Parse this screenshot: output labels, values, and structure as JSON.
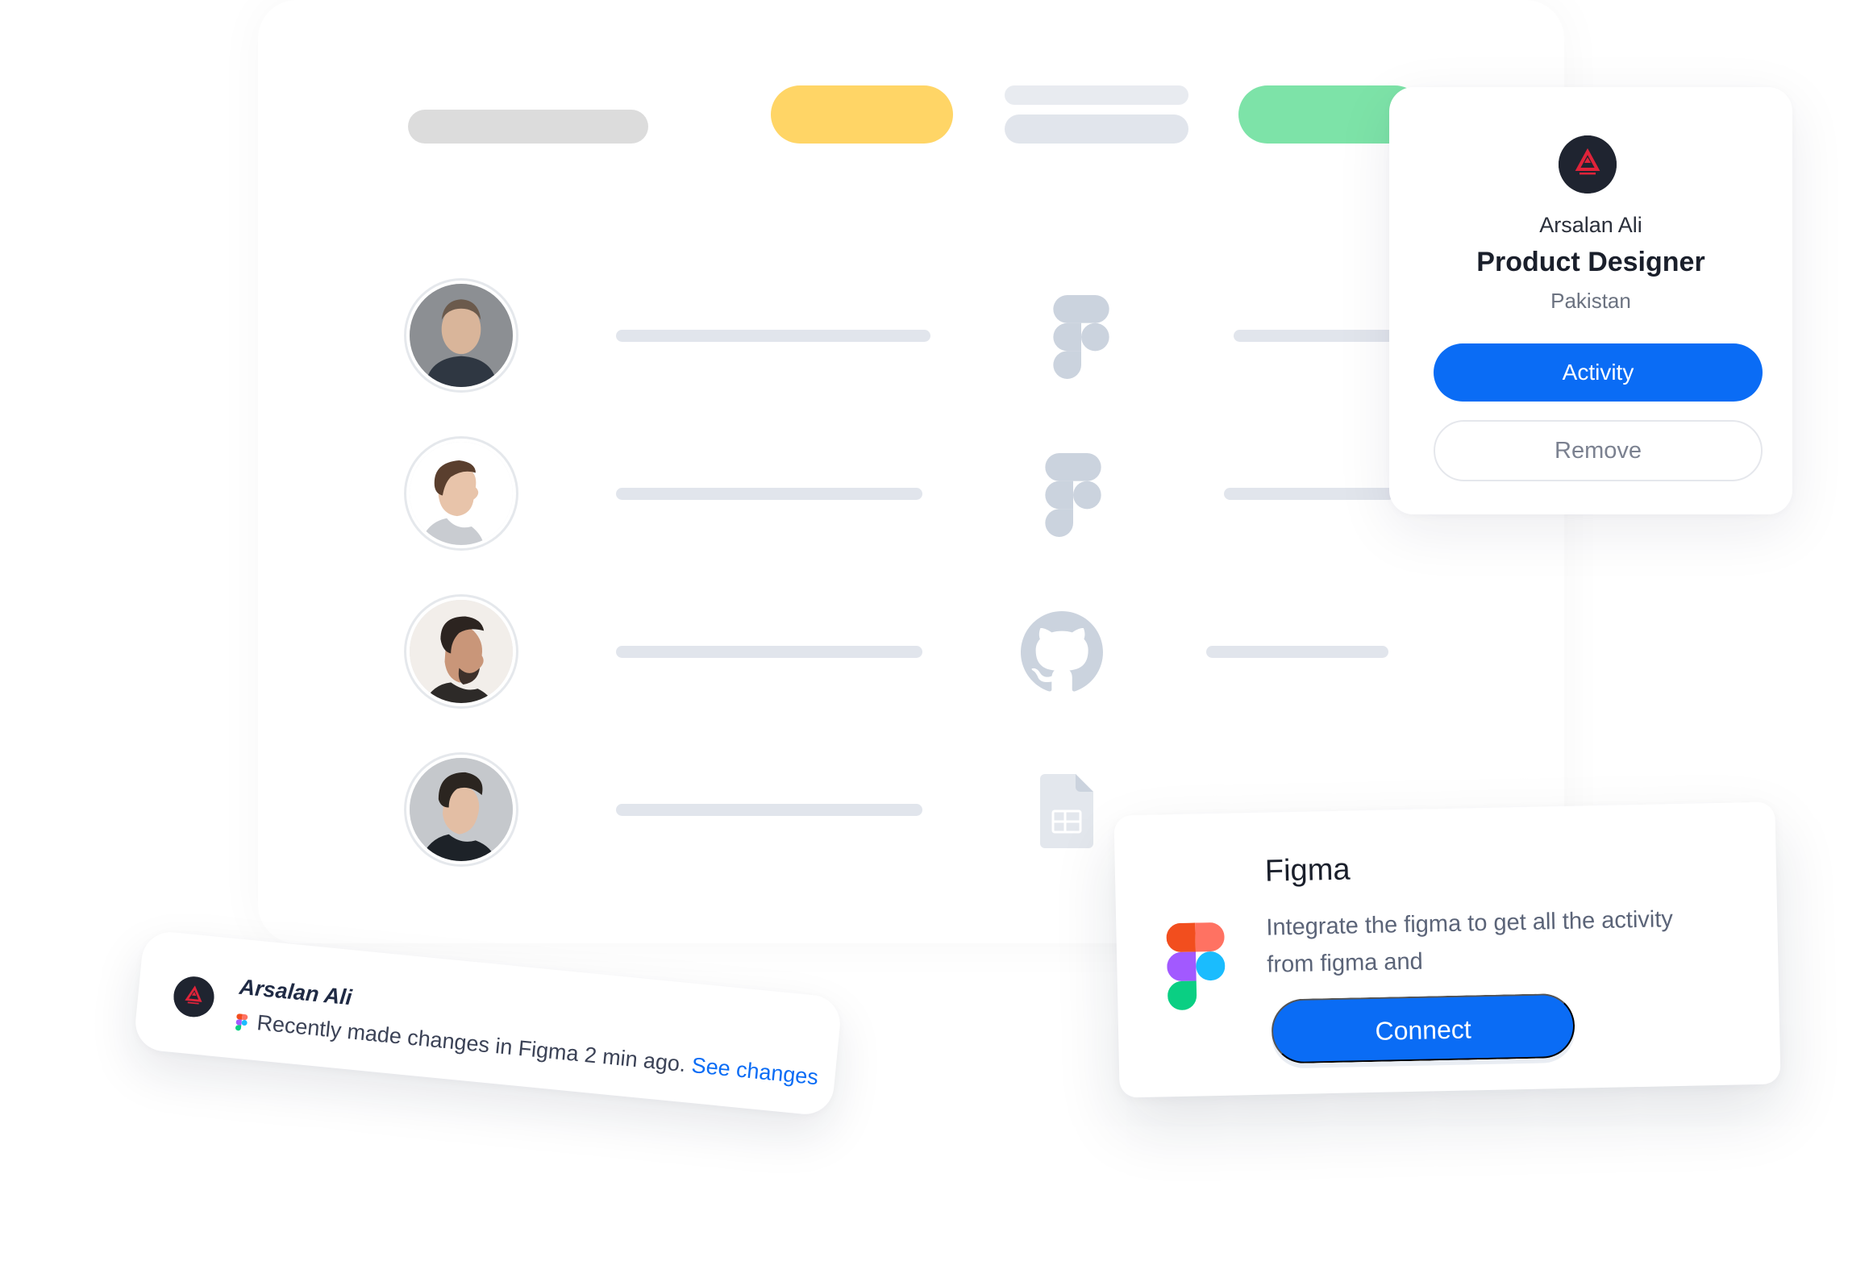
{
  "colors": {
    "accent_blue": "#0a6cf5",
    "pill_yellow": "#ffd566",
    "pill_green": "#7de3a8",
    "placeholder_gray": "#e1e5ec",
    "icon_gray": "#cbd3de"
  },
  "table": {
    "rows": [
      {
        "avatar": "person-avatar",
        "tool_icon": "figma-icon"
      },
      {
        "avatar": "person-avatar",
        "tool_icon": "figma-icon"
      },
      {
        "avatar": "person-avatar",
        "tool_icon": "github-icon"
      },
      {
        "avatar": "person-avatar",
        "tool_icon": "google-sheets-icon"
      }
    ]
  },
  "profile_card": {
    "name": "Arsalan Ali",
    "role": "Product Designer",
    "country": "Pakistan",
    "activity_label": "Activity",
    "remove_label": "Remove"
  },
  "notification": {
    "name": "Arsalan Ali",
    "message": "Recently made changes in Figma 2 min ago.",
    "link_label": "See changes"
  },
  "integration_card": {
    "title": "Figma",
    "description": "Integrate the figma to get all the activity from figma and",
    "button_label": "Connect"
  }
}
